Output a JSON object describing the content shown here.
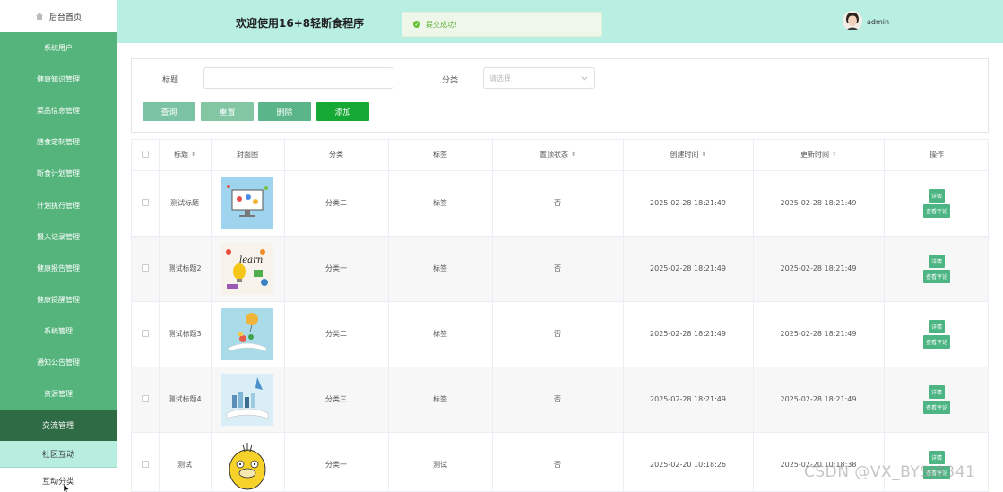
{
  "sidebar": {
    "home_label": "后台首页",
    "items": [
      {
        "label": "系统用户"
      },
      {
        "label": "健康知识管理"
      },
      {
        "label": "菜品信息管理"
      },
      {
        "label": "膳食定制管理"
      },
      {
        "label": "断食计划管理"
      },
      {
        "label": "计划执行管理"
      },
      {
        "label": "摄入记录管理"
      },
      {
        "label": "健康报告管理"
      },
      {
        "label": "健康提醒管理"
      },
      {
        "label": "系统管理"
      },
      {
        "label": "通知公告管理"
      },
      {
        "label": "资源管理"
      },
      {
        "label": "交流管理"
      }
    ],
    "sub_items": [
      {
        "label": "社区互动"
      },
      {
        "label": "互动分类"
      }
    ]
  },
  "header": {
    "title": "欢迎使用16+8轻断食程序",
    "toast": "提交成功!",
    "username": "admin"
  },
  "search": {
    "title_label": "标题",
    "title_value": "",
    "category_label": "分类",
    "category_placeholder": "请选择",
    "buttons": {
      "query": "查询",
      "reset": "重置",
      "delete": "删除",
      "add": "添加"
    }
  },
  "table": {
    "headers": [
      "标题",
      "封面图",
      "分类",
      "标签",
      "置顶状态",
      "创建时间",
      "更新时间",
      "操作"
    ],
    "rows": [
      {
        "title": "测试标题",
        "category": "分类二",
        "tag": "标签",
        "pinned": "否",
        "created": "2025-02-28 18:21:49",
        "updated": "2025-02-28 18:21:49",
        "cover": "computer-illustration"
      },
      {
        "title": "测试标题2",
        "category": "分类一",
        "tag": "标签",
        "pinned": "否",
        "created": "2025-02-28 18:21:49",
        "updated": "2025-02-28 18:21:49",
        "cover": "learn-lightbulb-illustration"
      },
      {
        "title": "测试标题3",
        "category": "分类二",
        "tag": "标签",
        "pinned": "否",
        "created": "2025-02-28 18:21:49",
        "updated": "2025-02-28 18:21:49",
        "cover": "open-book-balloon-illustration"
      },
      {
        "title": "测试标题4",
        "category": "分类三",
        "tag": "标签",
        "pinned": "否",
        "created": "2025-02-28 18:21:49",
        "updated": "2025-02-28 18:21:49",
        "cover": "open-book-city-illustration"
      },
      {
        "title": "测试",
        "category": "分类一",
        "tag": "测试",
        "pinned": "否",
        "created": "2025-02-20 10:18:26",
        "updated": "2025-02-20 10:18:38",
        "cover": "yellow-duck-cartoon"
      }
    ],
    "op_detail": "详情",
    "op_comments": "查看评论"
  },
  "watermark": "CSDN @VX_BYSJ8341",
  "colors": {
    "sidebar": "#55b47c",
    "sidebar_active": "#2f6b45",
    "header": "#b8efe2",
    "btn_query": "#7cc3a6",
    "btn_reset": "#82c6a4",
    "btn_delete": "#5bb58a",
    "btn_add": "#16a835",
    "op_button": "#4cb583"
  }
}
